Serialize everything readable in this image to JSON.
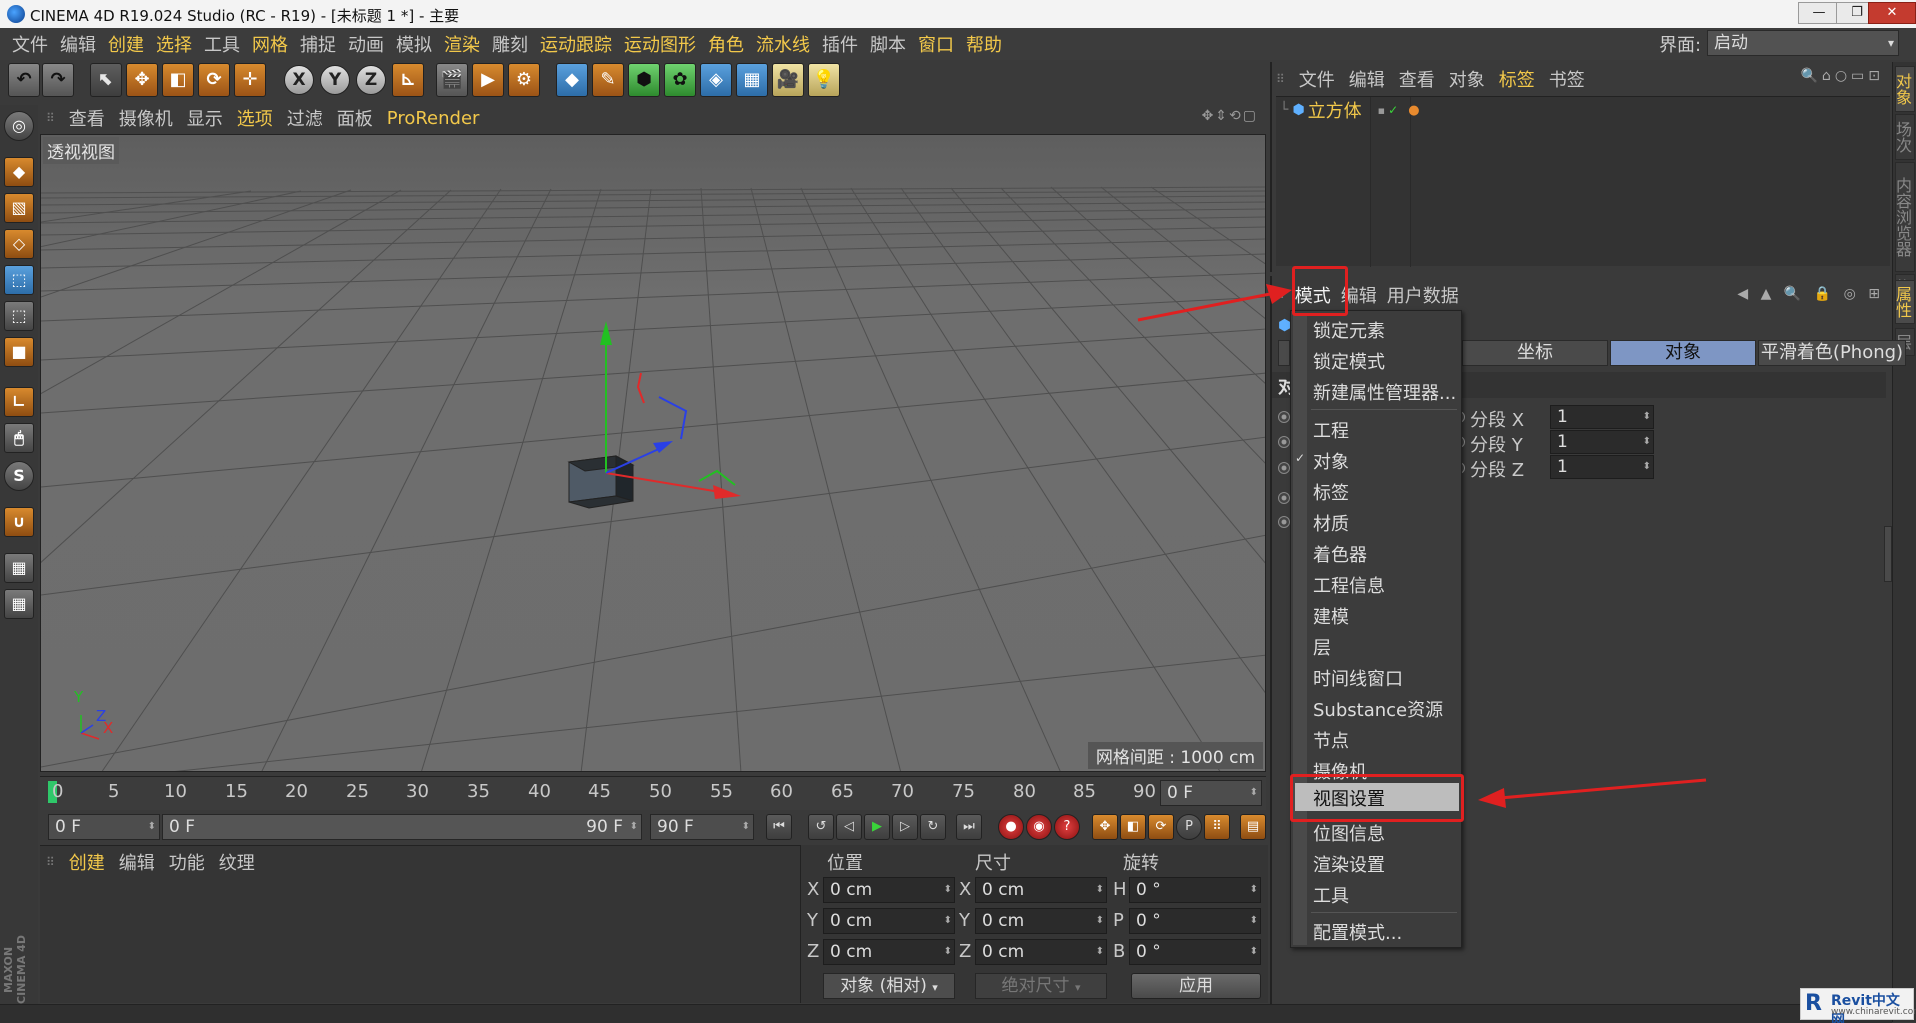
{
  "window": {
    "title": "CINEMA 4D R19.024 Studio (RC - R19) - [未标题 1 *] - 主要",
    "minimize": "—",
    "maximize": "❐",
    "close": "✕"
  },
  "menubar": {
    "items": [
      "文件",
      "编辑",
      "创建",
      "选择",
      "工具",
      "网格",
      "捕捉",
      "动画",
      "模拟",
      "渲染",
      "雕刻",
      "运动跟踪",
      "运动图形",
      "角色",
      "流水线",
      "插件",
      "脚本",
      "窗口",
      "帮助"
    ],
    "highlighted": [
      "创建",
      "选择",
      "网格",
      "渲染",
      "运动跟踪",
      "运动图形",
      "角色",
      "流水线",
      "窗口",
      "帮助"
    ],
    "layout_label": "界面:",
    "layout_value": "启动"
  },
  "viewport": {
    "menu": [
      "查看",
      "摄像机",
      "显示",
      "选项",
      "过滤",
      "面板",
      "ProRender"
    ],
    "highlighted": [
      "选项",
      "ProRender"
    ],
    "label": "透视视图",
    "grid_spacing": "网格间距 : 1000 cm",
    "axis_x": "X",
    "axis_y": "Y",
    "axis_z": "Z"
  },
  "timeline": {
    "ticks": [
      "0",
      "5",
      "10",
      "15",
      "20",
      "25",
      "30",
      "35",
      "40",
      "45",
      "50",
      "55",
      "60",
      "65",
      "70",
      "75",
      "80",
      "85",
      "90"
    ],
    "current_frame": "0 F",
    "start_field": "0 F",
    "range_start": "0 F",
    "range_end": "90 F",
    "end_field": "90 F"
  },
  "material_panel": {
    "tabs": [
      "创建",
      "编辑",
      "功能",
      "纹理"
    ],
    "highlighted": [
      "创建"
    ]
  },
  "coord_panel": {
    "headers": [
      "位置",
      "尺寸",
      "旋转"
    ],
    "rows": [
      {
        "pos_label": "X",
        "pos": "0 cm",
        "size_label": "X",
        "size": "0 cm",
        "rot_label": "H",
        "rot": "0 °"
      },
      {
        "pos_label": "Y",
        "pos": "0 cm",
        "size_label": "Y",
        "size": "0 cm",
        "rot_label": "P",
        "rot": "0 °"
      },
      {
        "pos_label": "Z",
        "pos": "0 cm",
        "size_label": "Z",
        "size": "0 cm",
        "rot_label": "B",
        "rot": "0 °"
      }
    ],
    "mode_select": "对象 (相对)",
    "size_select": "绝对尺寸",
    "apply": "应用"
  },
  "object_manager": {
    "tabs": [
      "文件",
      "编辑",
      "查看",
      "对象",
      "标签",
      "书签"
    ],
    "highlighted": [
      "标签"
    ],
    "object_name": "立方体"
  },
  "vertical_tabs": [
    "对象",
    "场次",
    "内容浏览器",
    "构",
    "属性",
    "层"
  ],
  "attribute_manager": {
    "tabs": [
      "模式",
      "编辑",
      "用户数据"
    ],
    "prop_tabs": [
      "坐标",
      "对象",
      "平滑着色(Phong)"
    ],
    "active_prop_tab": "对象",
    "section_title": "对",
    "segments": [
      {
        "label": "分段 X",
        "value": "1"
      },
      {
        "label": "分段 Y",
        "value": "1"
      },
      {
        "label": "分段 Z",
        "value": "1"
      }
    ]
  },
  "mode_menu": {
    "group1": [
      "锁定元素",
      "锁定模式",
      "新建属性管理器..."
    ],
    "group2": [
      "工程",
      "对象",
      "标签",
      "材质",
      "着色器",
      "工程信息",
      "建模",
      "层",
      "时间线窗口",
      "Substance资源",
      "节点",
      "摄像机",
      "视图设置",
      "位图信息",
      "渲染设置",
      "工具"
    ],
    "checked": "对象",
    "highlighted": "视图设置",
    "group3": [
      "配置模式..."
    ]
  },
  "annotations": {
    "color": "#e02020"
  },
  "watermark": {
    "logo": "R",
    "title": "Revit中文网",
    "url": "www.chinarevit.com"
  },
  "colors": {
    "accent_yellow": "#f2c84a",
    "panel_bg": "#3a3a3a",
    "active_tab": "#7e96c4"
  }
}
